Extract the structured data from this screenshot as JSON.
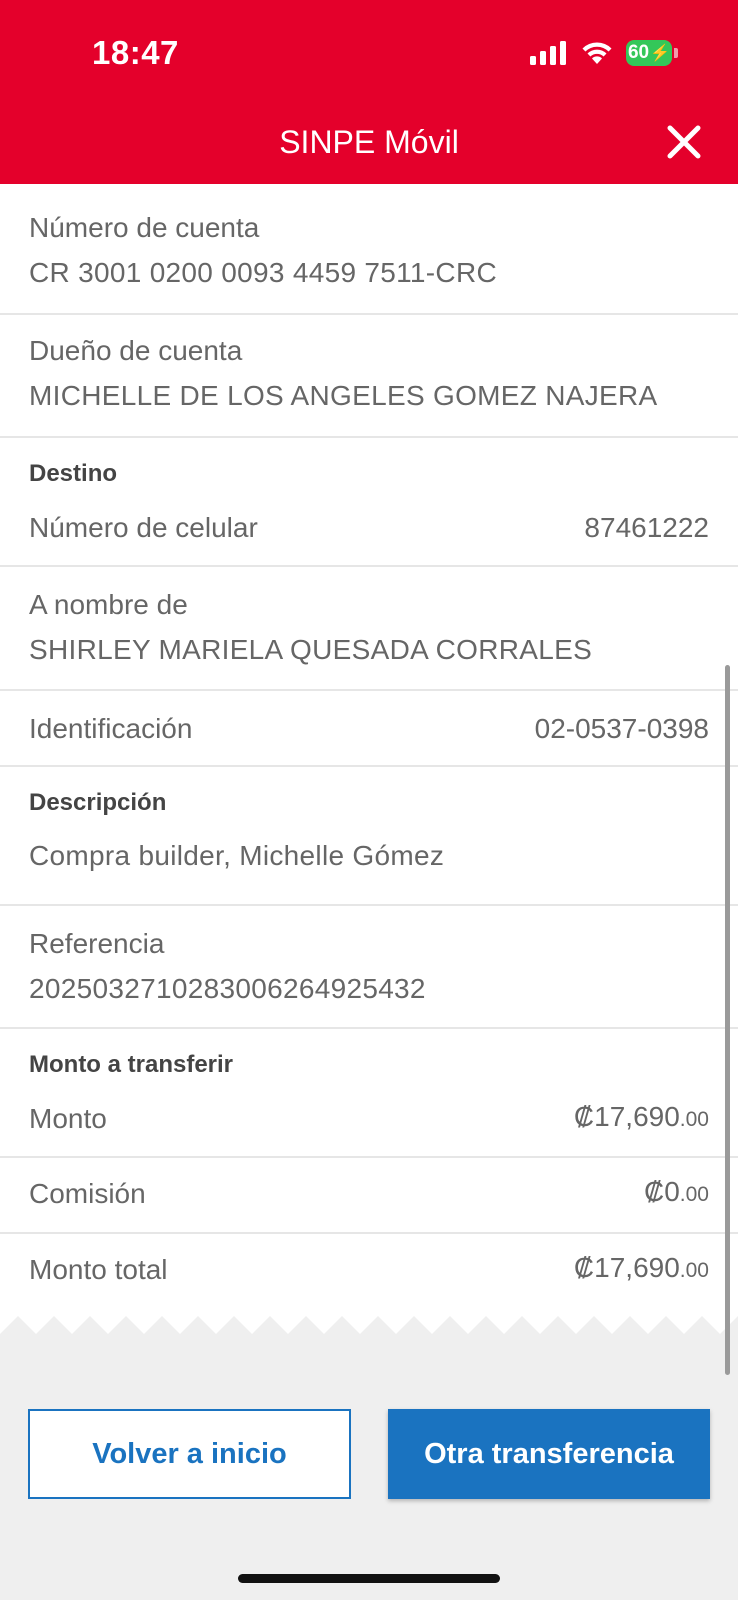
{
  "status_bar": {
    "time": "18:47",
    "battery": "60"
  },
  "header": {
    "title": "SINPE Móvil"
  },
  "origin": {
    "account_label": "Número de cuenta",
    "account_value": "CR 3001 0200 0093 4459 7511-CRC",
    "owner_label": "Dueño de cuenta",
    "owner_value": "MICHELLE DE LOS ANGELES GOMEZ NAJERA"
  },
  "destination": {
    "section": "Destino",
    "phone_label": "Número de celular",
    "phone_value": "87461222",
    "name_label": "A nombre de",
    "name_value": "SHIRLEY MARIELA QUESADA CORRALES",
    "id_label": "Identificación",
    "id_value": "02-0537-0398"
  },
  "description": {
    "section": "Descripción",
    "value": "Compra builder, Michelle Gómez"
  },
  "reference": {
    "label": "Referencia",
    "value": "2025032710283006264925432"
  },
  "amount": {
    "section": "Monto a transferir",
    "amount_label": "Monto",
    "amount_main": "₡17,690",
    "amount_cents": ".00",
    "fee_label": "Comisión",
    "fee_main": "₡0",
    "fee_cents": ".00",
    "total_label": "Monto total",
    "total_main": "₡17,690",
    "total_cents": ".00"
  },
  "buttons": {
    "back_home": "Volver a inicio",
    "another": "Otra transferencia"
  },
  "colors": {
    "header": "#e4002b",
    "primary": "#1a73c0",
    "battery": "#34c759"
  }
}
